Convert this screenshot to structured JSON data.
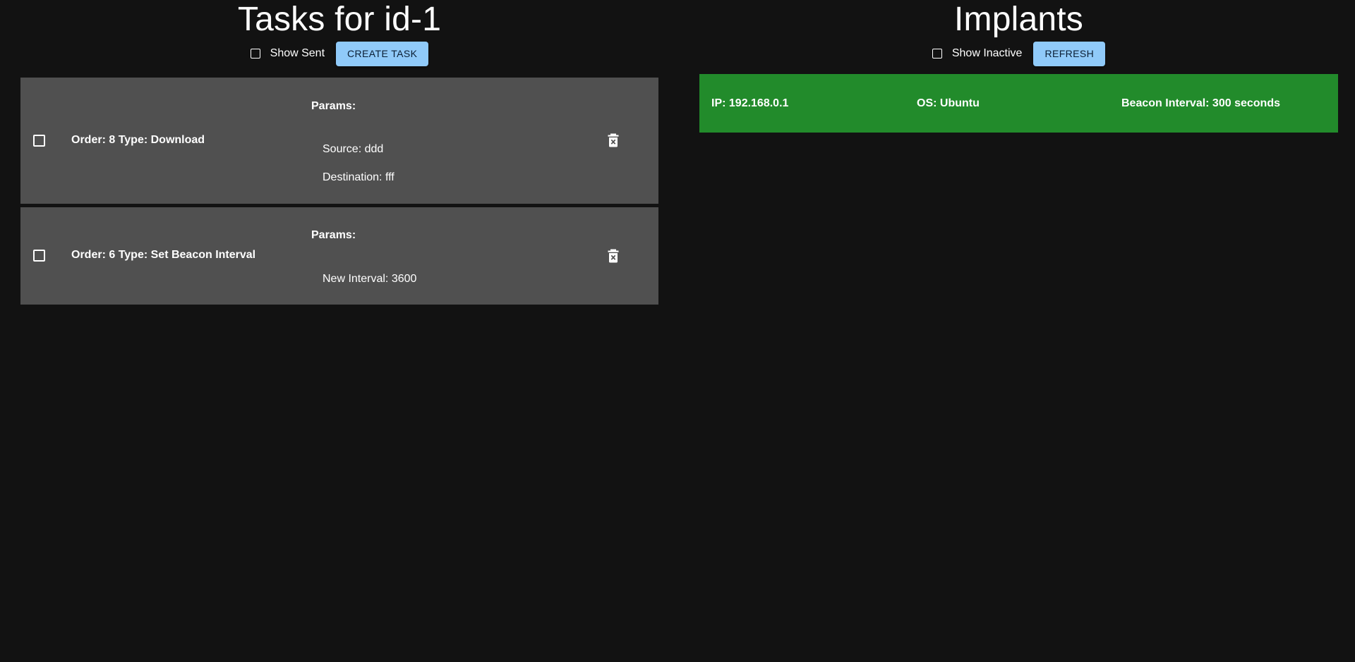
{
  "tasks_panel": {
    "title": "Tasks for id-1",
    "show_sent_label": "Show Sent",
    "create_button": "CREATE TASK",
    "params_label": "Params:",
    "tasks": [
      {
        "title": "Order: 8 Type: Download",
        "params": [
          "Source: ddd",
          "Destination: fff"
        ]
      },
      {
        "title": "Order: 6 Type: Set Beacon Interval",
        "params": [
          "New Interval: 3600"
        ]
      }
    ]
  },
  "implants_panel": {
    "title": "Implants",
    "show_inactive_label": "Show Inactive",
    "refresh_button": "REFRESH",
    "implants": [
      {
        "ip": "IP: 192.168.0.1",
        "os": "OS: Ubuntu",
        "beacon": "Beacon Interval: 300 seconds"
      }
    ]
  },
  "icons": {
    "checkbox": "checkbox-outline-icon",
    "delete": "trash-can-icon"
  },
  "colors": {
    "background": "#121212",
    "card": "#505050",
    "accent_button": "#90caf9",
    "active_implant": "#228b2b"
  }
}
